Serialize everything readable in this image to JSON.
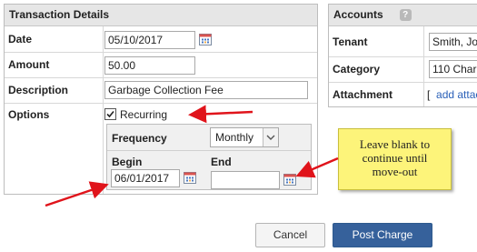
{
  "transaction": {
    "title": "Transaction Details",
    "date_label": "Date",
    "date_value": "05/10/2017",
    "amount_label": "Amount",
    "amount_value": "50.00",
    "description_label": "Description",
    "description_value": "Garbage Collection Fee",
    "options_label": "Options",
    "recurring_label": "Recurring",
    "recurring_checked": true,
    "frequency_label": "Frequency",
    "frequency_value": "Monthly",
    "begin_label": "Begin",
    "begin_value": "06/01/2017",
    "end_label": "End",
    "end_value": ""
  },
  "accounts": {
    "title": "Accounts",
    "help_glyph": "?",
    "tenant_label": "Tenant",
    "tenant_value": "Smith, Jo",
    "category_label": "Category",
    "category_value": "110 Charg",
    "attachment_label": "Attachment",
    "attachment_bracket": "[",
    "attachment_link": "add attac"
  },
  "note": {
    "text_line1": "Leave blank to",
    "text_line2": "continue until",
    "text_line3": "move-out"
  },
  "buttons": {
    "cancel": "Cancel",
    "post": "Post Charge"
  },
  "colors": {
    "arrow": "#e0141b",
    "note_bg": "#fdf47a",
    "primary_button": "#36619b"
  }
}
